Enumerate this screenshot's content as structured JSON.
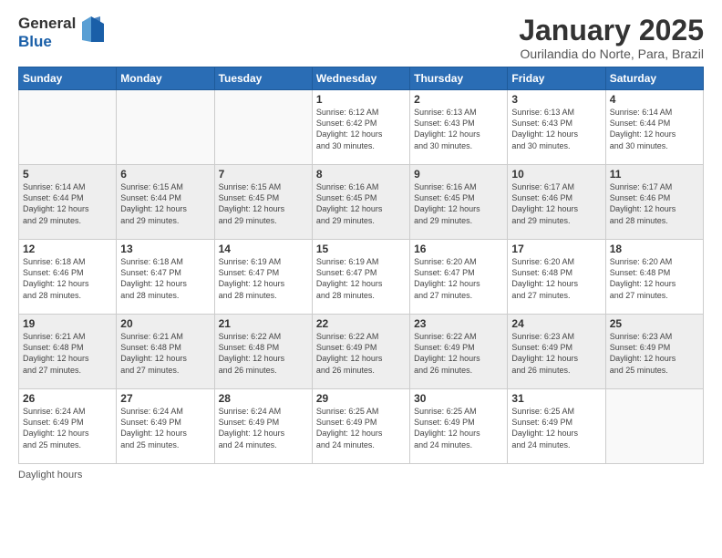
{
  "logo": {
    "general": "General",
    "blue": "Blue"
  },
  "title": "January 2025",
  "location": "Ourilandia do Norte, Para, Brazil",
  "days_of_week": [
    "Sunday",
    "Monday",
    "Tuesday",
    "Wednesday",
    "Thursday",
    "Friday",
    "Saturday"
  ],
  "weeks": [
    [
      {
        "day": "",
        "info": ""
      },
      {
        "day": "",
        "info": ""
      },
      {
        "day": "",
        "info": ""
      },
      {
        "day": "1",
        "info": "Sunrise: 6:12 AM\nSunset: 6:42 PM\nDaylight: 12 hours\nand 30 minutes."
      },
      {
        "day": "2",
        "info": "Sunrise: 6:13 AM\nSunset: 6:43 PM\nDaylight: 12 hours\nand 30 minutes."
      },
      {
        "day": "3",
        "info": "Sunrise: 6:13 AM\nSunset: 6:43 PM\nDaylight: 12 hours\nand 30 minutes."
      },
      {
        "day": "4",
        "info": "Sunrise: 6:14 AM\nSunset: 6:44 PM\nDaylight: 12 hours\nand 30 minutes."
      }
    ],
    [
      {
        "day": "5",
        "info": "Sunrise: 6:14 AM\nSunset: 6:44 PM\nDaylight: 12 hours\nand 29 minutes."
      },
      {
        "day": "6",
        "info": "Sunrise: 6:15 AM\nSunset: 6:44 PM\nDaylight: 12 hours\nand 29 minutes."
      },
      {
        "day": "7",
        "info": "Sunrise: 6:15 AM\nSunset: 6:45 PM\nDaylight: 12 hours\nand 29 minutes."
      },
      {
        "day": "8",
        "info": "Sunrise: 6:16 AM\nSunset: 6:45 PM\nDaylight: 12 hours\nand 29 minutes."
      },
      {
        "day": "9",
        "info": "Sunrise: 6:16 AM\nSunset: 6:45 PM\nDaylight: 12 hours\nand 29 minutes."
      },
      {
        "day": "10",
        "info": "Sunrise: 6:17 AM\nSunset: 6:46 PM\nDaylight: 12 hours\nand 29 minutes."
      },
      {
        "day": "11",
        "info": "Sunrise: 6:17 AM\nSunset: 6:46 PM\nDaylight: 12 hours\nand 28 minutes."
      }
    ],
    [
      {
        "day": "12",
        "info": "Sunrise: 6:18 AM\nSunset: 6:46 PM\nDaylight: 12 hours\nand 28 minutes."
      },
      {
        "day": "13",
        "info": "Sunrise: 6:18 AM\nSunset: 6:47 PM\nDaylight: 12 hours\nand 28 minutes."
      },
      {
        "day": "14",
        "info": "Sunrise: 6:19 AM\nSunset: 6:47 PM\nDaylight: 12 hours\nand 28 minutes."
      },
      {
        "day": "15",
        "info": "Sunrise: 6:19 AM\nSunset: 6:47 PM\nDaylight: 12 hours\nand 28 minutes."
      },
      {
        "day": "16",
        "info": "Sunrise: 6:20 AM\nSunset: 6:47 PM\nDaylight: 12 hours\nand 27 minutes."
      },
      {
        "day": "17",
        "info": "Sunrise: 6:20 AM\nSunset: 6:48 PM\nDaylight: 12 hours\nand 27 minutes."
      },
      {
        "day": "18",
        "info": "Sunrise: 6:20 AM\nSunset: 6:48 PM\nDaylight: 12 hours\nand 27 minutes."
      }
    ],
    [
      {
        "day": "19",
        "info": "Sunrise: 6:21 AM\nSunset: 6:48 PM\nDaylight: 12 hours\nand 27 minutes."
      },
      {
        "day": "20",
        "info": "Sunrise: 6:21 AM\nSunset: 6:48 PM\nDaylight: 12 hours\nand 27 minutes."
      },
      {
        "day": "21",
        "info": "Sunrise: 6:22 AM\nSunset: 6:48 PM\nDaylight: 12 hours\nand 26 minutes."
      },
      {
        "day": "22",
        "info": "Sunrise: 6:22 AM\nSunset: 6:49 PM\nDaylight: 12 hours\nand 26 minutes."
      },
      {
        "day": "23",
        "info": "Sunrise: 6:22 AM\nSunset: 6:49 PM\nDaylight: 12 hours\nand 26 minutes."
      },
      {
        "day": "24",
        "info": "Sunrise: 6:23 AM\nSunset: 6:49 PM\nDaylight: 12 hours\nand 26 minutes."
      },
      {
        "day": "25",
        "info": "Sunrise: 6:23 AM\nSunset: 6:49 PM\nDaylight: 12 hours\nand 25 minutes."
      }
    ],
    [
      {
        "day": "26",
        "info": "Sunrise: 6:24 AM\nSunset: 6:49 PM\nDaylight: 12 hours\nand 25 minutes."
      },
      {
        "day": "27",
        "info": "Sunrise: 6:24 AM\nSunset: 6:49 PM\nDaylight: 12 hours\nand 25 minutes."
      },
      {
        "day": "28",
        "info": "Sunrise: 6:24 AM\nSunset: 6:49 PM\nDaylight: 12 hours\nand 24 minutes."
      },
      {
        "day": "29",
        "info": "Sunrise: 6:25 AM\nSunset: 6:49 PM\nDaylight: 12 hours\nand 24 minutes."
      },
      {
        "day": "30",
        "info": "Sunrise: 6:25 AM\nSunset: 6:49 PM\nDaylight: 12 hours\nand 24 minutes."
      },
      {
        "day": "31",
        "info": "Sunrise: 6:25 AM\nSunset: 6:49 PM\nDaylight: 12 hours\nand 24 minutes."
      },
      {
        "day": "",
        "info": ""
      }
    ]
  ],
  "footer": {
    "daylight_label": "Daylight hours"
  }
}
